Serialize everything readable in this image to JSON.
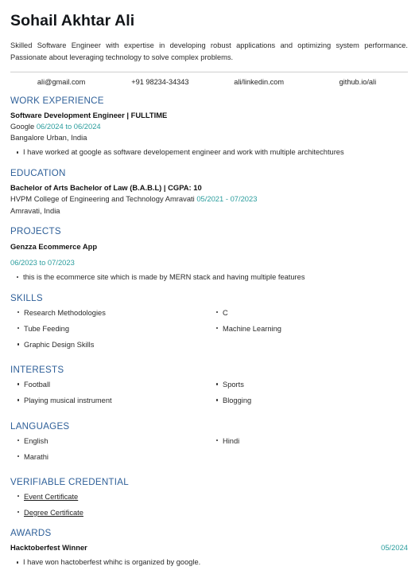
{
  "header": {
    "name": "Sohail Akhtar Ali",
    "summary": "Skilled Software Engineer with expertise in developing robust applications and optimizing system performance. Passionate about leveraging technology to solve complex problems.",
    "contacts": [
      {
        "label": "ali@gmail.com",
        "kind": "email"
      },
      {
        "label": "+91 98234-34343",
        "kind": "phone"
      },
      {
        "label": "ali/linkedin.com",
        "kind": "linkedin"
      },
      {
        "label": "github.io/ali",
        "kind": "github"
      }
    ]
  },
  "sections": {
    "work": {
      "title": "WORK EXPERIENCE",
      "entries": [
        {
          "role": "Software Development Engineer | FULLTIME",
          "company": "Google",
          "dates": "06/2024 to 06/2024",
          "location": "Bangalore Urban, India",
          "bullets": [
            "I have worked at google as software developement engineer and work with multiple architechtures"
          ]
        }
      ]
    },
    "education": {
      "title": "EDUCATION",
      "entries": [
        {
          "degree": "Bachelor of Arts Bachelor of Law (B.A.B.L) | CGPA: 10",
          "institution": "HVPM College of Engineering and Technology Amravati",
          "dates": "05/2021 - 07/2023",
          "location": "Amravati, India"
        }
      ]
    },
    "projects": {
      "title": "PROJECTS",
      "entries": [
        {
          "name": "Genzza Ecommerce App",
          "dates": "06/2023 to 07/2023",
          "bullets": [
            "this is the ecommerce site which is made by MERN stack and having multiple features"
          ]
        }
      ]
    },
    "skills": {
      "title": "SKILLS",
      "left": [
        "Research Methodologies",
        "Tube Feeding",
        "Graphic Design Skills"
      ],
      "right": [
        "C",
        "Machine Learning"
      ]
    },
    "interests": {
      "title": "INTERESTS",
      "left": [
        "Football",
        "Playing musical instrument"
      ],
      "right": [
        "Sports",
        "Blogging"
      ]
    },
    "languages": {
      "title": "LANGUAGES",
      "left": [
        "English",
        "Marathi"
      ],
      "right": [
        "Hindi"
      ]
    },
    "credentials": {
      "title": "VERIFIABLE CREDENTIAL",
      "items": [
        "Event Certificate",
        "Degree Certificate"
      ]
    },
    "awards": {
      "title": "AWARDS",
      "entries": [
        {
          "name": "Hacktoberfest Winner",
          "date": "05/2024",
          "bullets": [
            "I have won hactoberfest whihc is organized by google."
          ]
        }
      ]
    }
  },
  "colors": {
    "heading_blue": "#2f6099",
    "date_teal": "#2a9d9d",
    "body_text": "#2b2b2b",
    "divider": "#cfcfcf"
  }
}
